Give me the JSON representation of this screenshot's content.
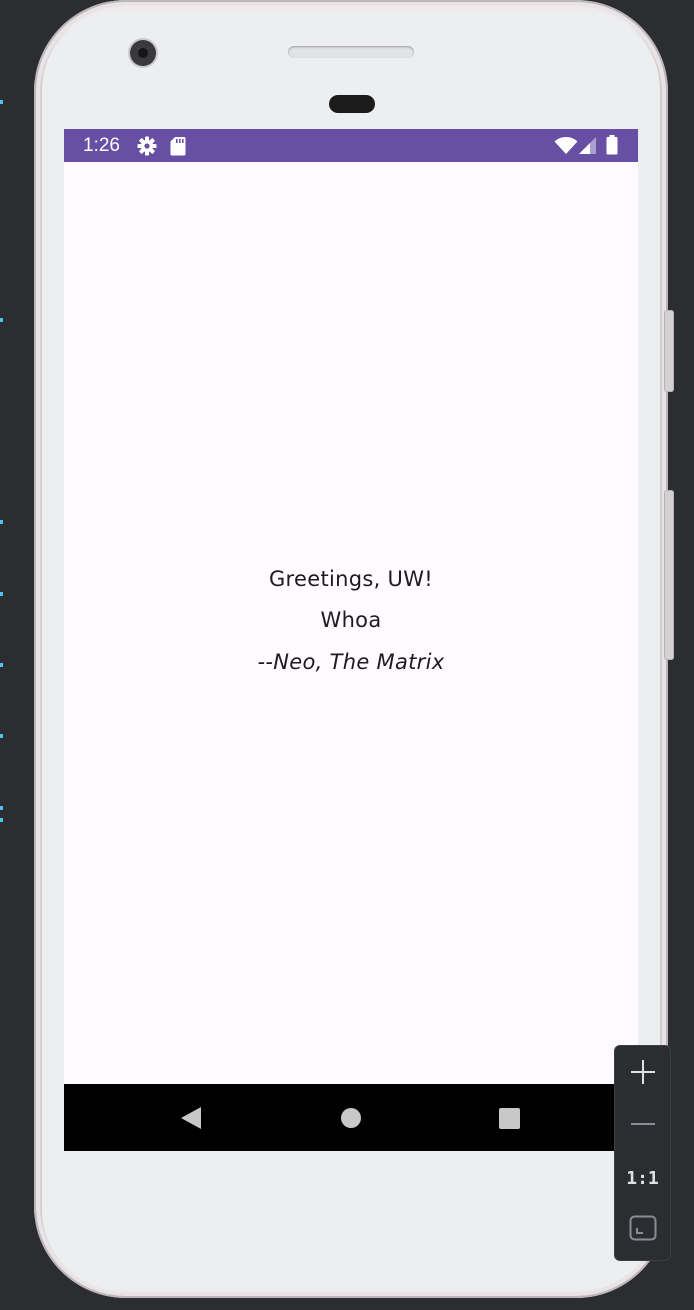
{
  "status_bar": {
    "time": "1:26",
    "color": "#6750a4",
    "icons": [
      "settings-gear-icon",
      "sd-card-icon",
      "wifi-icon",
      "cell-signal-icon",
      "battery-icon"
    ]
  },
  "content": {
    "greeting": "Greetings, UW!",
    "quote": "Whoa",
    "attribution": "--Neo, The Matrix"
  },
  "nav_bar": {
    "buttons": [
      "back-icon",
      "home-icon",
      "recents-icon"
    ]
  },
  "emulator_zoom": {
    "zoom_in_icon": "plus-icon",
    "zoom_out_icon": "minus-icon",
    "actual_size_label": "1:1",
    "fit_screen_icon": "fit-screen-icon"
  }
}
